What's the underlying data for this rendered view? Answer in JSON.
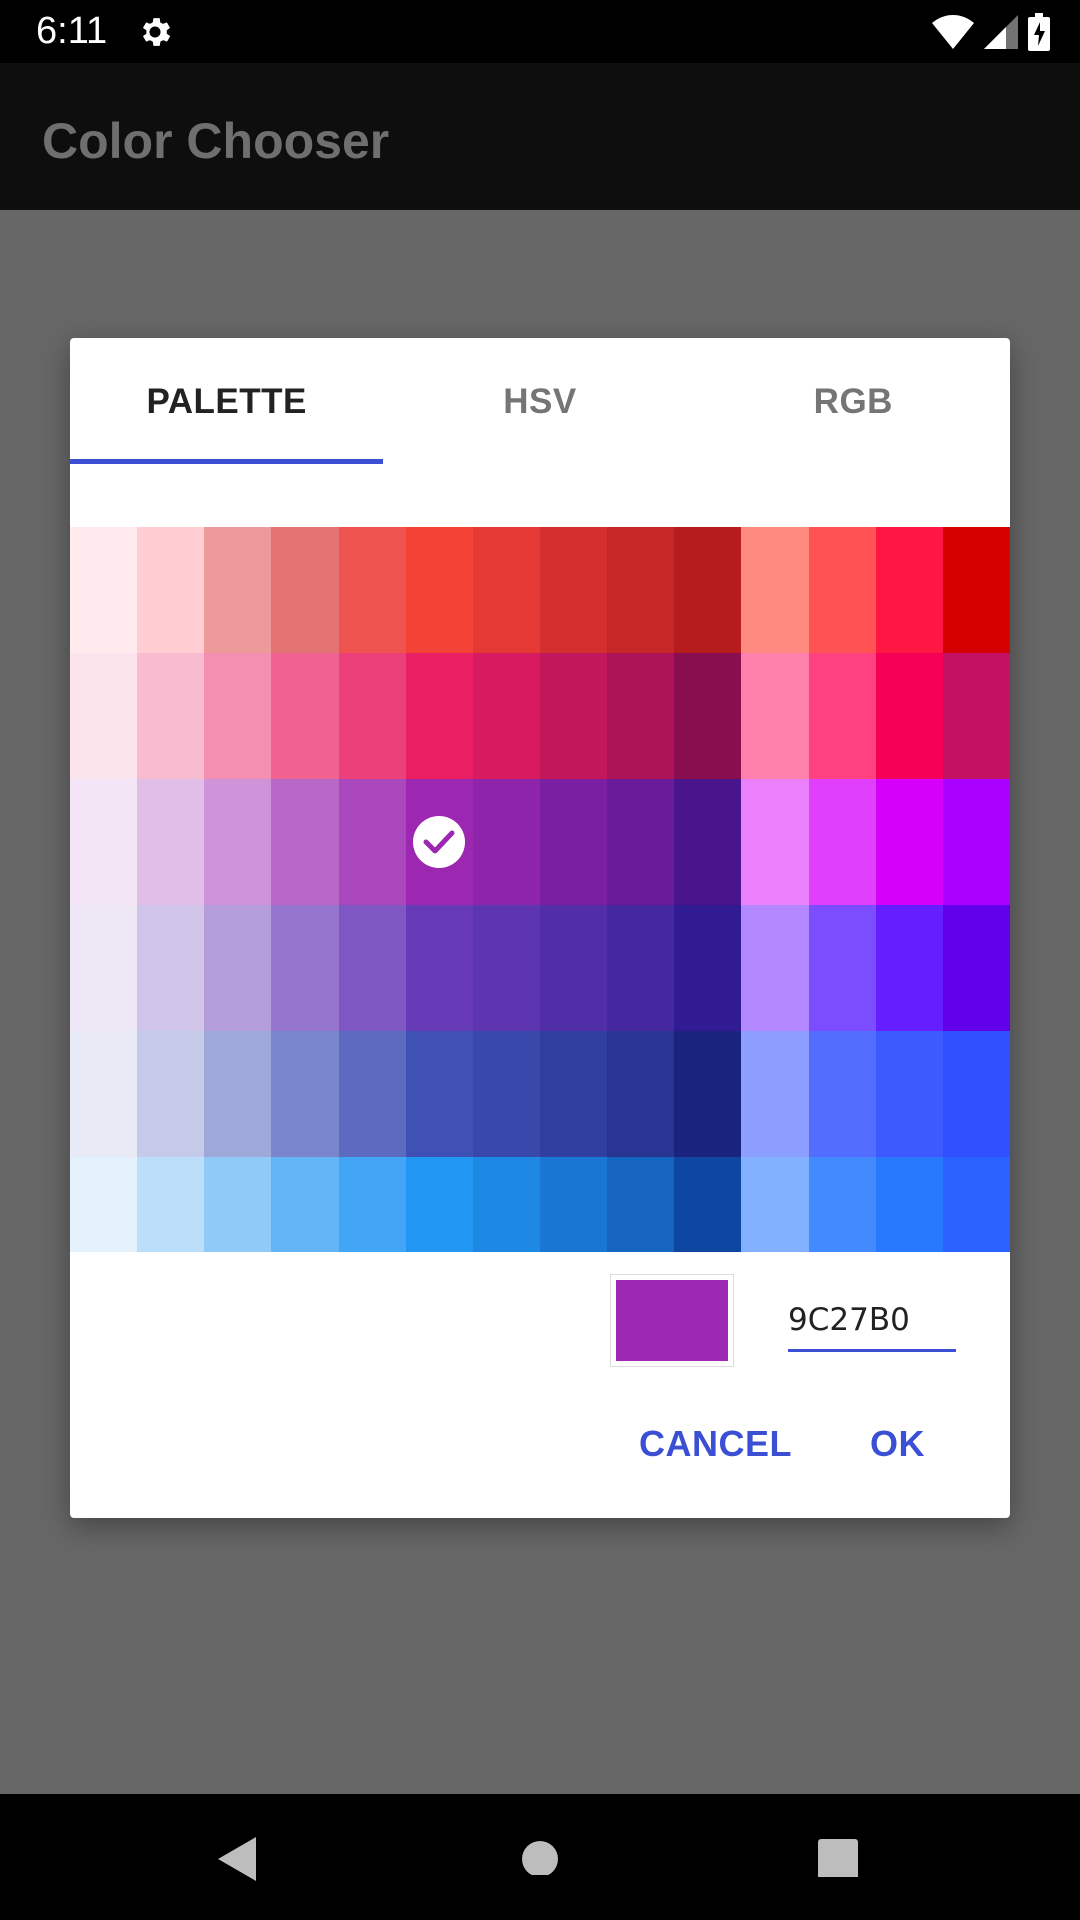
{
  "status_bar": {
    "time": "6:11",
    "icons": [
      "gear-icon",
      "wifi-icon",
      "cell-signal-icon",
      "battery-icon"
    ]
  },
  "app_bar": {
    "title": "Color Chooser"
  },
  "dialog": {
    "tabs": [
      {
        "label": "PALETTE",
        "active": true
      },
      {
        "label": "HSV",
        "active": false
      },
      {
        "label": "RGB",
        "active": false
      }
    ],
    "palette": {
      "rows": [
        [
          "#FFEBEE",
          "#FFCDD2",
          "#EF9A9A",
          "#E57373",
          "#EF5350",
          "#F44336",
          "#E53935",
          "#D32F2F",
          "#C62828",
          "#B71C1C",
          "#FF8A80",
          "#FF5252",
          "#FF1744",
          "#D50000"
        ],
        [
          "#FCE4EC",
          "#F8BBD0",
          "#F48FB1",
          "#F06292",
          "#EC407A",
          "#E91E63",
          "#D81B60",
          "#C2185B",
          "#AD1457",
          "#880E4F",
          "#FF80AB",
          "#FF4081",
          "#F50057",
          "#C51162"
        ],
        [
          "#F3E5F5",
          "#E1BEE7",
          "#CE93D8",
          "#BA68C8",
          "#AB47BC",
          "#9C27B0",
          "#8E24AA",
          "#7B1FA2",
          "#6A1B9A",
          "#4A148C",
          "#EA80FC",
          "#E040FB",
          "#D500F9",
          "#AA00FF"
        ],
        [
          "#EDE7F6",
          "#D1C4E9",
          "#B39DDB",
          "#9575CD",
          "#7E57C2",
          "#673AB7",
          "#5E35B1",
          "#512DA8",
          "#4527A0",
          "#311B92",
          "#B388FF",
          "#7C4DFF",
          "#651FFF",
          "#6200EA"
        ],
        [
          "#E8EAF6",
          "#C5CAE9",
          "#9FA8DA",
          "#7986CB",
          "#5C6BC0",
          "#3F51B5",
          "#3949AB",
          "#303F9F",
          "#283593",
          "#1A237E",
          "#8C9EFF",
          "#536DFE",
          "#3D5AFE",
          "#304FFE"
        ],
        [
          "#E3F2FD",
          "#BBDEFB",
          "#90CAF9",
          "#64B5F6",
          "#42A5F5",
          "#2196F3",
          "#1E88E5",
          "#1976D2",
          "#1565C0",
          "#0D47A1",
          "#82B1FF",
          "#448AFF",
          "#2979FF",
          "#2962FF"
        ]
      ],
      "selected": {
        "row": 2,
        "col": 5
      }
    },
    "selected_color": "#9C27B0",
    "hex_value": "9C27B0",
    "cancel_label": "CANCEL",
    "ok_label": "OK"
  },
  "nav_bar": {
    "icons": [
      "back-icon",
      "home-icon",
      "recents-icon"
    ]
  },
  "colors": {
    "accent": "#3A4FD4"
  }
}
